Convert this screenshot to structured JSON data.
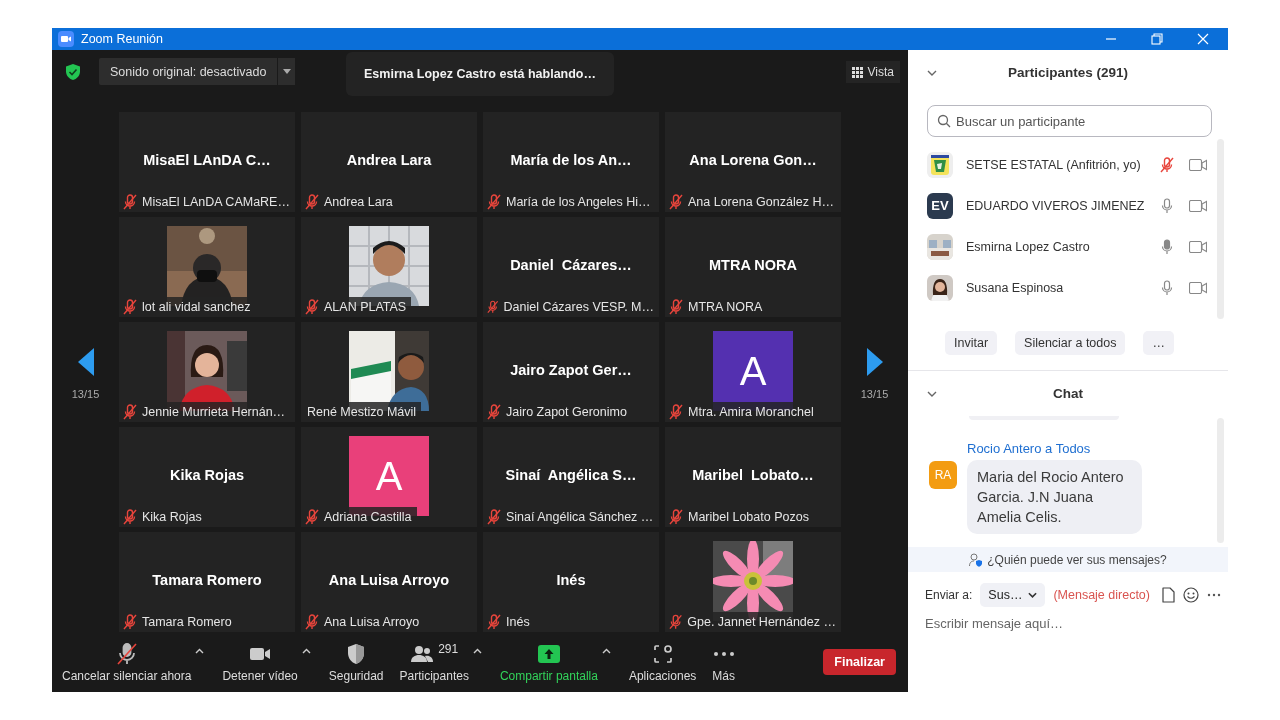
{
  "window": {
    "title": "Zoom Reunión"
  },
  "top_bar": {
    "audio_button": "Sonido original: desactivado",
    "speaking_banner": "Esmirna Lopez Castro está hablando…",
    "view_button": "Vista"
  },
  "gallery": {
    "page_prev": "13/15",
    "page_next": "13/15",
    "tiles": [
      {
        "kind": "name",
        "display": "MisaEl LAnDA C…",
        "label": "MisaEl LAnDA CAMaRE…",
        "muted": true
      },
      {
        "kind": "name",
        "display": "Andrea Lara",
        "label": "Andrea Lara",
        "muted": true
      },
      {
        "kind": "name",
        "display": "María de los An…",
        "label": "María de los Angeles Hi…",
        "muted": true
      },
      {
        "kind": "name",
        "display": "Ana Lorena Gon…",
        "label": "Ana Lorena González H…",
        "muted": true
      },
      {
        "kind": "picture",
        "label": "lot ali vidal sanchez",
        "muted": true
      },
      {
        "kind": "picture",
        "label": "ALAN PLATAS",
        "muted": true
      },
      {
        "kind": "name",
        "display": "Daniel  Cázares…",
        "label": "Daniel Cázares VESP. M…",
        "muted": true
      },
      {
        "kind": "name",
        "display": "MTRA NORA",
        "label": "MTRA NORA",
        "muted": true
      },
      {
        "kind": "picture",
        "label": "Jennie Murrieta Hernán…",
        "muted": true
      },
      {
        "kind": "picture",
        "label": "René Mestizo Mávil",
        "muted": false
      },
      {
        "kind": "name",
        "display": "Jairo Zapot Ger…",
        "label": "Jairo Zapot Geronimo",
        "muted": true
      },
      {
        "kind": "letter",
        "letter": "A",
        "color": "#5430b0",
        "label": "Mtra. Amira Moranchel",
        "muted": true
      },
      {
        "kind": "name",
        "display": "Kika Rojas",
        "label": "Kika Rojas",
        "muted": true
      },
      {
        "kind": "letter",
        "letter": "A",
        "color": "#e9407a",
        "label": "Adriana Castilla",
        "muted": true
      },
      {
        "kind": "name",
        "display": "Sinaí  Angélica S…",
        "label": "Sinaí Angélica Sánchez …",
        "muted": true
      },
      {
        "kind": "name",
        "display": "Maribel  Lobato…",
        "label": "Maribel Lobato Pozos",
        "muted": true
      },
      {
        "kind": "name",
        "display": "Tamara Romero",
        "label": "Tamara Romero",
        "muted": true
      },
      {
        "kind": "name",
        "display": "Ana Luisa Arroyo",
        "label": "Ana Luisa Arroyo",
        "muted": true
      },
      {
        "kind": "name",
        "display": "Inés",
        "label": "Inés",
        "muted": true
      },
      {
        "kind": "picture",
        "label": "Gpe. Jannet Hernández …",
        "muted": true
      }
    ]
  },
  "toolbar": {
    "items": [
      {
        "kind": "mic_muted",
        "label": "Cancelar silenciar ahora",
        "caret": true
      },
      {
        "kind": "video",
        "label": "Detener vídeo",
        "caret": true
      },
      {
        "kind": "security",
        "label": "Seguridad",
        "caret": false
      },
      {
        "kind": "participants",
        "label": "Participantes",
        "count": "291",
        "caret": true
      },
      {
        "kind": "share",
        "label": "Compartir pantalla",
        "caret": true
      },
      {
        "kind": "apps",
        "label": "Aplicaciones",
        "caret": false
      },
      {
        "kind": "more",
        "label": "Más",
        "caret": false
      }
    ],
    "end_button": "Finalizar"
  },
  "participants": {
    "title": "Participantes (291)",
    "search_placeholder": "Buscar un participante",
    "list": [
      {
        "name": "SETSE ESTATAL (Anfitrión, yo)",
        "kind": "picture",
        "muted": true
      },
      {
        "name": "EDUARDO VIVEROS JIMENEZ",
        "kind": "initials",
        "initials": "EV",
        "color": "#2b3a4f",
        "muted": false,
        "speaking": false
      },
      {
        "name": "Esmirna Lopez Castro",
        "kind": "picture",
        "muted": false,
        "speaking": true
      },
      {
        "name": "Susana Espinosa",
        "kind": "picture",
        "muted": false,
        "speaking": false
      }
    ],
    "buttons": [
      "Invitar",
      "Silenciar a todos",
      "…"
    ]
  },
  "chat": {
    "title": "Chat",
    "messages": [
      {
        "header": "Rocio Antero a Todos",
        "initials": "RA",
        "color": "#f39c12",
        "text": "Maria del Rocio Antero Garcia. J.N Juana Amelia Celis."
      }
    ],
    "privacy_note": "¿Quién puede ver sus mensajes?",
    "send_to_label": "Enviar a:",
    "recipient": "Sus…",
    "recipient_note": "(Mensaje directo)",
    "input_placeholder": "Escribir mensaje aquí…"
  }
}
